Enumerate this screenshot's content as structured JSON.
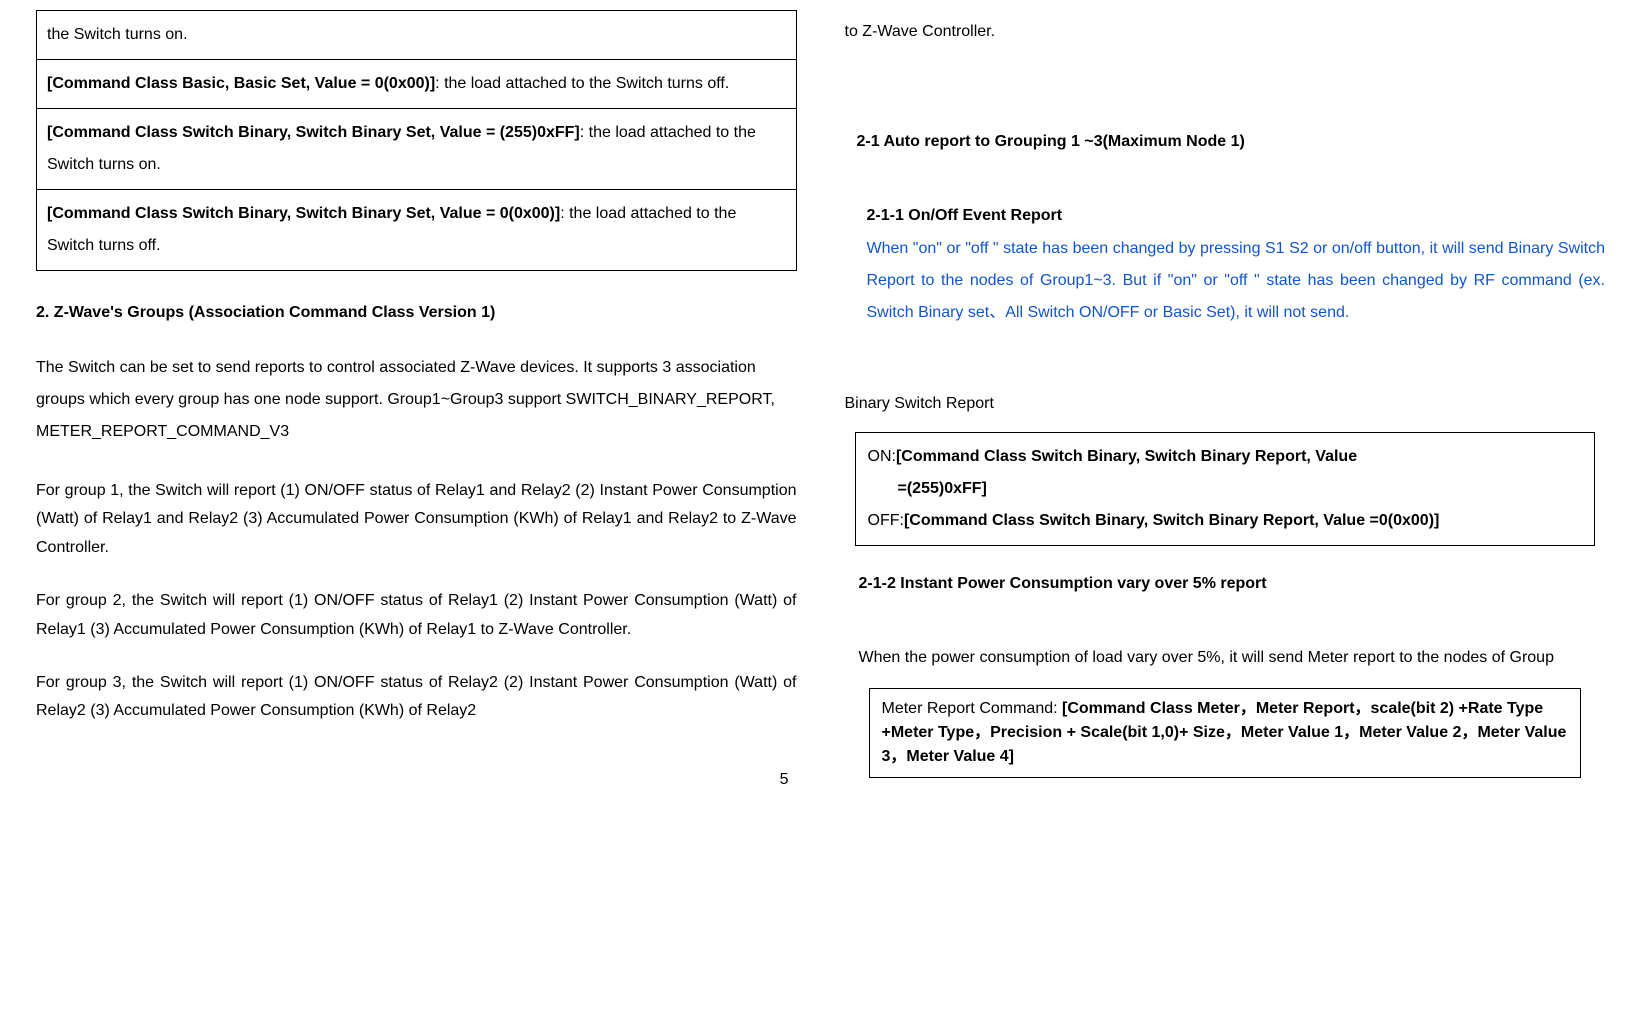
{
  "left": {
    "table": {
      "r1": "the Switch turns on.",
      "r2": {
        "bold": "[Command Class Basic, Basic Set, Value = 0(0x00)]",
        "rest": ": the load attached to the Switch turns off."
      },
      "r3": {
        "bold": "[Command Class Switch Binary, Switch Binary Set, Value = (255)0xFF]",
        "rest": ": the load attached to the Switch turns on."
      },
      "r4": {
        "bold": "[Command Class Switch Binary, Switch Binary Set, Value = 0(0x00)]",
        "rest": ": the load attached to the Switch turns off."
      }
    },
    "heading2": "2.    Z-Wave's Groups (Association Command Class Version 1)",
    "para1": "The Switch can be set to send reports to control associated Z-Wave devices.  It supports 3 association groups which every group has one node support. Group1~Group3 support SWITCH_BINARY_REPORT, METER_REPORT_COMMAND_V3",
    "para2": "For group 1, the Switch will report (1) ON/OFF status of Relay1 and Relay2 (2) Instant Power Consumption (Watt) of Relay1 and Relay2 (3) Accumulated Power Consumption (KWh) of Relay1 and Relay2 to Z-Wave Controller.",
    "para3": "For group 2, the Switch will report (1) ON/OFF status of Relay1 (2) Instant Power Consumption (Watt) of Relay1 (3) Accumulated Power Consumption (KWh) of Relay1 to Z-Wave Controller.",
    "para4": "For group 3, the Switch will report (1) ON/OFF status of Relay2 (2) Instant Power Consumption (Watt) of Relay2 (3) Accumulated Power Consumption (KWh) of Relay2",
    "pagenum": "5"
  },
  "right": {
    "cont": "to Z-Wave Controller.",
    "s21": "2-1 Auto report to Grouping 1 ~3(Maximum Node 1)",
    "s211": "2-1-1 On/Off Event Report",
    "blue": "When \"on\" or \"off \" state has been changed by pressing S1 S2 or on/off button, it will send Binary Switch Report to the nodes of Group1~3. But if \"on\" or \"off \" state has been changed by RF command (ex. Switch Binary set、All Switch ON/OFF or Basic Set), it will not send.",
    "bsr": "Binary Switch Report",
    "box1": {
      "on_prefix": "ON:",
      "on_bold_l1": "[Command Class Switch Binary, Switch Binary Report, Value",
      "on_bold_l2": "=(255)0xFF]",
      "off_prefix": "OFF:",
      "off_bold_l1": "[Command Class Switch Binary, Switch Binary Report, Value =0(0x00)]"
    },
    "s212": "2-1-2 Instant Power Consumption vary over 5% report",
    "para5": "When the power consumption of load vary over 5%, it will send Meter report to the nodes of Group",
    "box2": {
      "prefix": "Meter Report Command: ",
      "bold": "[Command Class Meter，Meter Report，scale(bit 2) +Rate Type +Meter Type，Precision + Scale(bit 1,0)+ Size，Meter Value 1，Meter Value 2，Meter Value 3，Meter Value 4]"
    }
  }
}
